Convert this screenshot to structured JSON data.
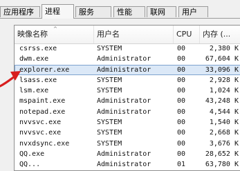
{
  "tabs": [
    {
      "label": "应用程序",
      "active": false
    },
    {
      "label": "进程",
      "active": true
    },
    {
      "label": "服务",
      "active": false
    },
    {
      "label": "性能",
      "active": false
    },
    {
      "label": "联网",
      "active": false
    },
    {
      "label": "用户",
      "active": false
    }
  ],
  "table": {
    "columns": [
      "映像名称",
      "用户名",
      "CPU",
      "内存 (..."
    ],
    "sort_arrow": "^",
    "rows": [
      {
        "name": "csrss.exe",
        "user": "SYSTEM",
        "cpu": "00",
        "mem": "2,380 K"
      },
      {
        "name": "dwm.exe",
        "user": "Administrator",
        "cpu": "00",
        "mem": "67,604 K"
      },
      {
        "name": "explorer.exe",
        "user": "Administrator",
        "cpu": "00",
        "mem": "33,096 K",
        "selected": true
      },
      {
        "name": "lsass.exe",
        "user": "SYSTEM",
        "cpu": "00",
        "mem": "2,928 K"
      },
      {
        "name": "lsm.exe",
        "user": "SYSTEM",
        "cpu": "00",
        "mem": "1,024 K"
      },
      {
        "name": "mspaint.exe",
        "user": "Administrator",
        "cpu": "00",
        "mem": "43,248 K"
      },
      {
        "name": "notepad.exe",
        "user": "Administrator",
        "cpu": "00",
        "mem": "4,544 K"
      },
      {
        "name": "nvvsvc.exe",
        "user": "SYSTEM",
        "cpu": "00",
        "mem": "1,540 K"
      },
      {
        "name": "nvvsvc.exe",
        "user": "SYSTEM",
        "cpu": "00",
        "mem": "2,668 K"
      },
      {
        "name": "nvxdsync.exe",
        "user": "SYSTEM",
        "cpu": "00",
        "mem": "3,676 K"
      },
      {
        "name": "QQ.exe",
        "user": "Administrator",
        "cpu": "00",
        "mem": "28,652 K"
      },
      {
        "name": "QQ...",
        "user": "Administrator",
        "cpu": "01",
        "mem": "63,780 K"
      }
    ]
  },
  "colors": {
    "selection": "#dbe8f7",
    "annotation_arrow": "#d81e1e"
  },
  "icons": {
    "annotation": "red-arrow-icon"
  }
}
